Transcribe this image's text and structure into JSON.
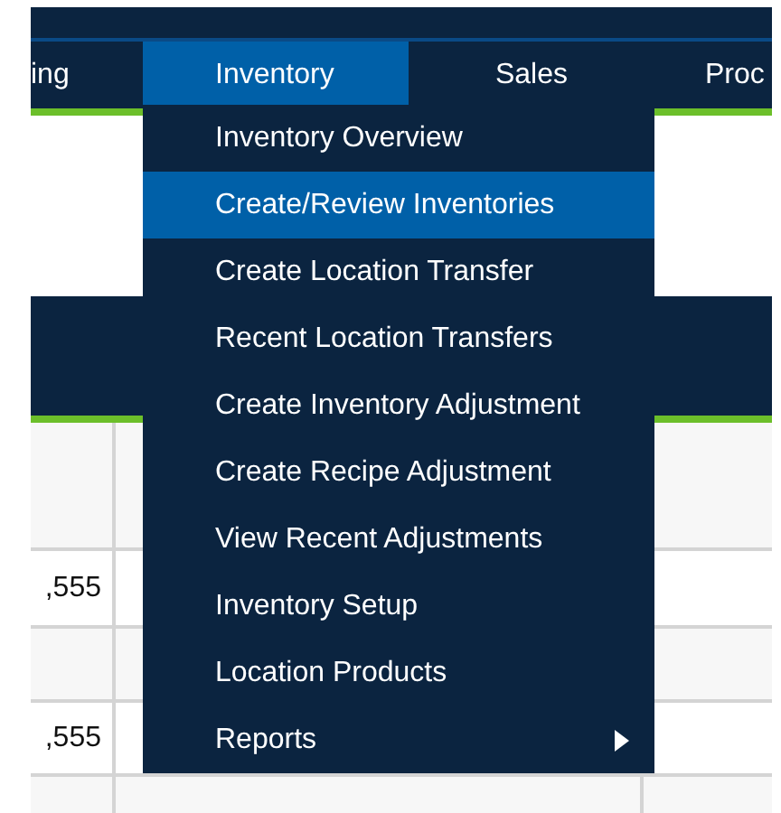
{
  "nav": {
    "tabs": [
      {
        "label": "ing",
        "selected": false
      },
      {
        "label": "Inventory",
        "selected": true
      },
      {
        "label": "Sales",
        "selected": false
      },
      {
        "label": "Proc",
        "selected": false
      }
    ]
  },
  "menu": {
    "items": [
      {
        "label": "Inventory Overview",
        "selected": false,
        "has_submenu": false
      },
      {
        "label": "Create/Review Inventories",
        "selected": true,
        "has_submenu": false
      },
      {
        "label": "Create Location Transfer",
        "selected": false,
        "has_submenu": false
      },
      {
        "label": "Recent Location Transfers",
        "selected": false,
        "has_submenu": false
      },
      {
        "label": "Create Inventory Adjustment",
        "selected": false,
        "has_submenu": false
      },
      {
        "label": "Create Recipe Adjustment",
        "selected": false,
        "has_submenu": false
      },
      {
        "label": "View Recent Adjustments",
        "selected": false,
        "has_submenu": false
      },
      {
        "label": "Inventory Setup",
        "selected": false,
        "has_submenu": false
      },
      {
        "label": "Location Products",
        "selected": false,
        "has_submenu": false
      },
      {
        "label": "Reports",
        "selected": false,
        "has_submenu": true
      }
    ]
  },
  "table": {
    "rows": [
      {
        "column_1": ",555"
      },
      {
        "column_1": ",555"
      }
    ]
  }
}
